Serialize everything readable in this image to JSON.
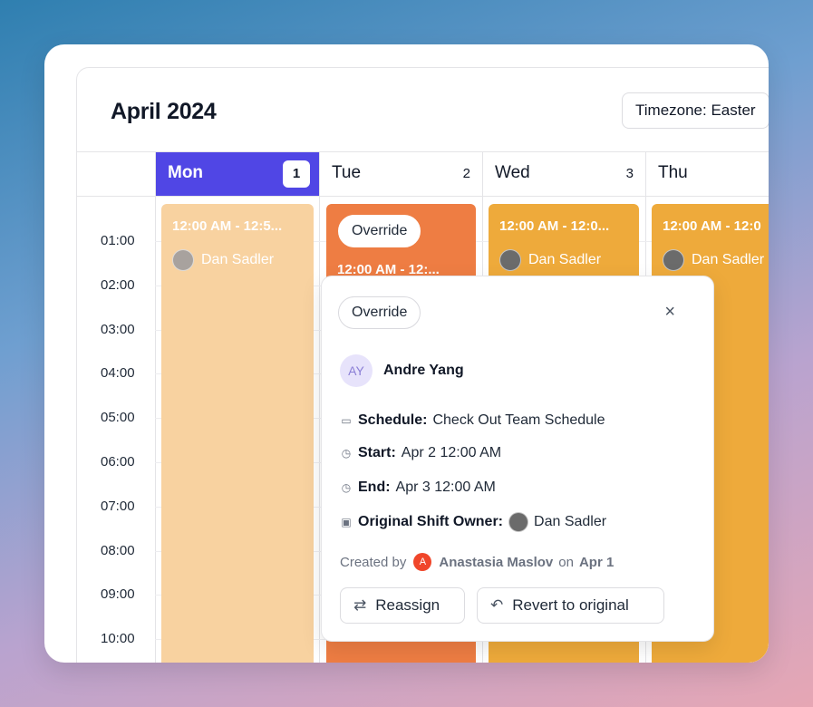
{
  "calendar": {
    "title": "April 2024",
    "timezone_label": "Timezone: Easter",
    "days": [
      {
        "name": "Mon",
        "num": "1"
      },
      {
        "name": "Tue",
        "num": "2"
      },
      {
        "name": "Wed",
        "num": "3"
      },
      {
        "name": "Thu",
        "num": ""
      }
    ],
    "hours": [
      "01:00",
      "02:00",
      "03:00",
      "04:00",
      "05:00",
      "06:00",
      "07:00",
      "08:00",
      "09:00",
      "10:00"
    ]
  },
  "events": {
    "mon": {
      "time": "12:00 AM - 12:5...",
      "owner": "Dan Sadler"
    },
    "tue": {
      "badge": "Override",
      "time": "12:00 AM - 12:..."
    },
    "wed": {
      "time": "12:00 AM - 12:0...",
      "owner": "Dan Sadler"
    },
    "thu": {
      "time": "12:00 AM - 12:0",
      "owner": "Dan Sadler"
    }
  },
  "popover": {
    "badge": "Override",
    "close": "×",
    "avatar_initials": "AY",
    "person": "Andre Yang",
    "schedule_label": "Schedule:",
    "schedule_value": "Check Out Team Schedule",
    "start_label": "Start:",
    "start_value": "Apr 2 12:00 AM",
    "end_label": "End:",
    "end_value": "Apr 3 12:00 AM",
    "owner_label": "Original Shift Owner:",
    "owner_value": "Dan Sadler",
    "created_by": "Created by",
    "creator_initial": "A",
    "creator": "Anastasia Maslov",
    "on": "on",
    "created_date": "Apr 1",
    "reassign": "Reassign",
    "revert": "Revert to original"
  },
  "colors": {
    "accent": "#5046e5",
    "mon_event": "#f8d2a0",
    "tue_event": "#ee7d43",
    "wed_event": "#eeaa3b"
  }
}
